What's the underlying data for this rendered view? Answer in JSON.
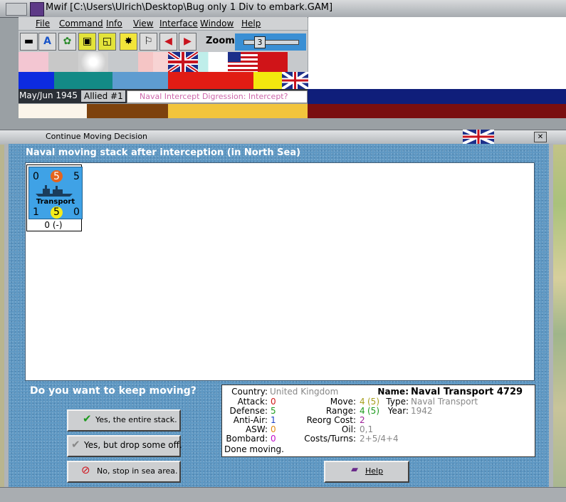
{
  "main_window": {
    "title": "Mwif [C:\\Users\\Ulrich\\Desktop\\Bug only 1 Div to embark.GAM]"
  },
  "menu": {
    "items": [
      "File",
      "Command",
      "Info",
      "View",
      "Interface",
      "Window",
      "Help"
    ]
  },
  "toolbar": {
    "zoom_label": "Zoom",
    "zoom_value": "3"
  },
  "status": {
    "date": "May/Jun 1945",
    "side": "Allied #1",
    "phase": "Naval Intercept Digression: Intercept?"
  },
  "dialog": {
    "title": "Continue Moving Decision",
    "heading": "Naval moving stack after interception (in North Sea)",
    "question": "Do you want to keep moving?",
    "buttons": {
      "yes_all": "Yes, the entire stack.",
      "yes_drop": "Yes, but drop some off.",
      "no_stop": "No, stop in sea area.",
      "help": "Help"
    }
  },
  "unit_counter": {
    "top_left": "0",
    "top_mid": "5",
    "top_right": "5",
    "bottom_left": "1",
    "bottom_mid": "5",
    "bottom_right": "0",
    "label": "Transport",
    "sub_label": "0 (-)",
    "colors": {
      "card": "#3fa2e6",
      "top_circle": "#e5641e",
      "bottom_circle": "#f5ec1a"
    }
  },
  "unit_info": {
    "country_label": "Country:",
    "country": "United Kingdom",
    "name_label": "Name:",
    "name": "Naval Transport 4729",
    "attack_label": "Attack:",
    "attack": "0",
    "defense_label": "Defense:",
    "defense": "5",
    "antiair_label": "Anti-Air:",
    "antiair": "1",
    "asw_label": "ASW:",
    "asw": "0",
    "bombard_label": "Bombard:",
    "bombard": "0",
    "done": "Done moving.",
    "move_label": "Move:",
    "move": "4",
    "move_extra": "(5)",
    "range_label": "Range:",
    "range": "4",
    "range_extra": "(5)",
    "type_label": "Type:",
    "type": "Naval Transport",
    "year_label": "Year:",
    "year": "1942",
    "reorg_label": "Reorg Cost:",
    "reorg": "2",
    "oil_label": "Oil:",
    "oil": "0,1",
    "costs_label": "Costs/Turns:",
    "costs": "2+5/4+4"
  }
}
